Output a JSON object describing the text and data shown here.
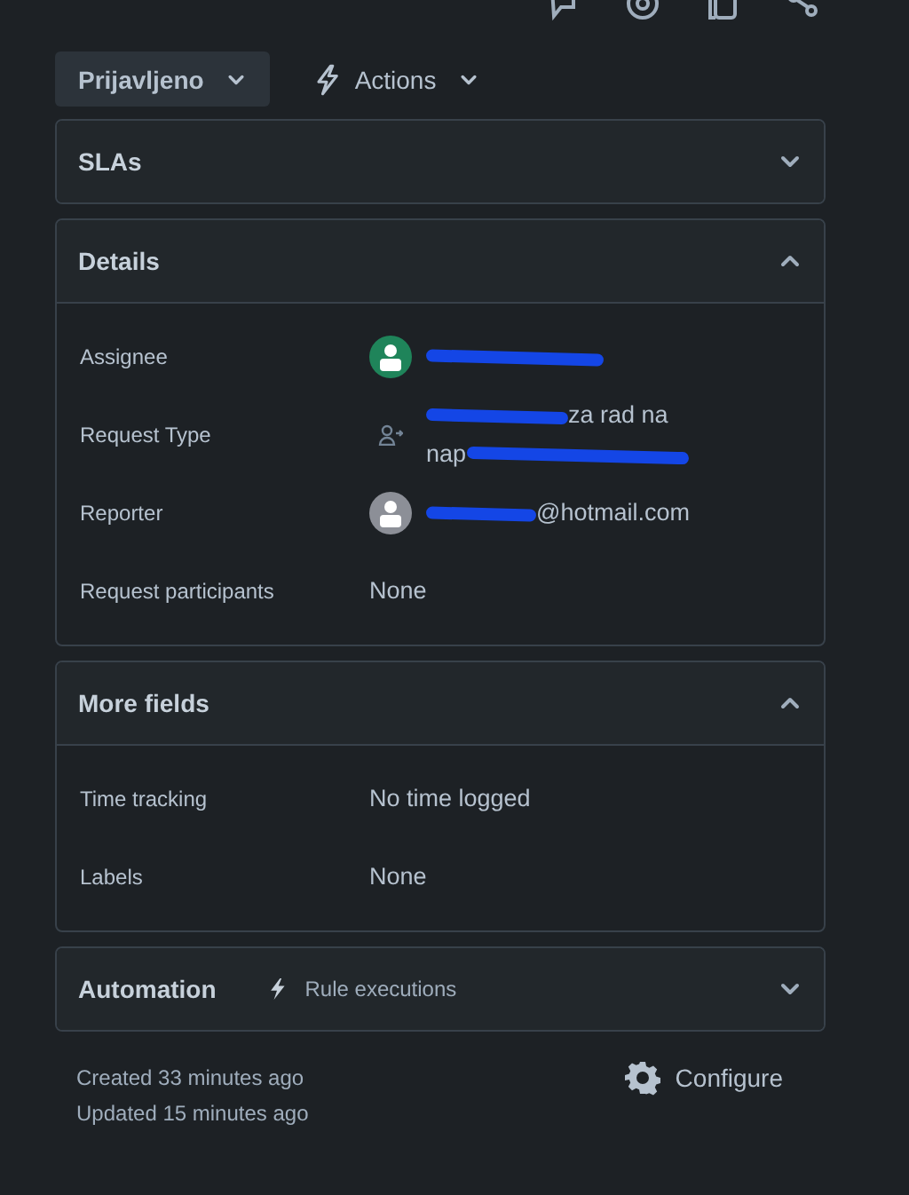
{
  "status_button": {
    "label": "Prijavljeno"
  },
  "actions_button": {
    "label": "Actions"
  },
  "panels": [
    {
      "title": "SLAs",
      "expanded": false
    },
    {
      "title": "Details",
      "expanded": true,
      "fields": [
        {
          "label": "Assignee",
          "kind": "user",
          "color": "#1f845a",
          "lines": [
            {
              "redacted_before": true,
              "redacted_after": false
            }
          ]
        },
        {
          "label": "Request Type",
          "kind": "request_type",
          "lines": [
            {
              "text": "za rad na",
              "redacted_before": true,
              "redacted_after": false
            },
            {
              "text": "nap",
              "redacted_before": false,
              "redacted_after": true
            }
          ]
        },
        {
          "label": "Reporter",
          "kind": "user",
          "color": "#8c8f97",
          "lines": [
            {
              "text": "@hotmail.com",
              "redacted_before": true,
              "redacted_after": false
            }
          ]
        },
        {
          "label": "Request participants",
          "kind": "text",
          "lines": [
            {
              "text": "None",
              "redacted_before": false,
              "redacted_after": false
            }
          ]
        }
      ]
    },
    {
      "title": "More fields",
      "expanded": true,
      "fields": [
        {
          "label": "Time tracking",
          "kind": "text",
          "lines": [
            {
              "text": "No time logged",
              "redacted_before": false,
              "redacted_after": false
            }
          ]
        },
        {
          "label": "Labels",
          "kind": "text",
          "lines": [
            {
              "text": "None",
              "redacted_before": false,
              "redacted_after": false
            }
          ]
        }
      ]
    },
    {
      "title": "Automation",
      "expanded": false,
      "subtitle": "Rule executions"
    }
  ],
  "created": "Created 33 minutes ago",
  "updated": "Updated 15 minutes ago",
  "configure_button": {
    "label": "Configure"
  }
}
